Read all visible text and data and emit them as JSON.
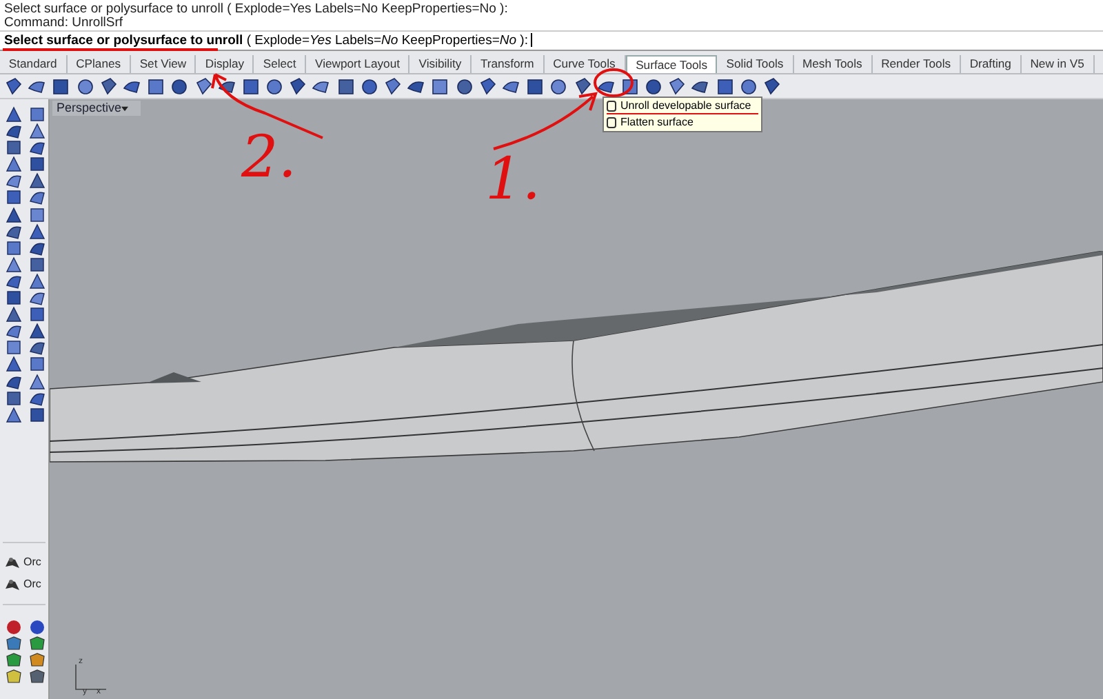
{
  "command_history": [
    "Select surface or polysurface to unroll ( Explode=Yes  Labels=No  KeepProperties=No ):",
    "Command:  UnrollSrf"
  ],
  "command_prompt": {
    "prompt": "Select surface or polysurface to unroll",
    "options": "( Explode=*Yes*  Labels=*No*  KeepProperties=*No* ):"
  },
  "tabs": [
    {
      "label": "Standard",
      "selected": false
    },
    {
      "label": "CPlanes",
      "selected": false
    },
    {
      "label": "Set View",
      "selected": false
    },
    {
      "label": "Display",
      "selected": false
    },
    {
      "label": "Select",
      "selected": false
    },
    {
      "label": "Viewport Layout",
      "selected": false
    },
    {
      "label": "Visibility",
      "selected": false
    },
    {
      "label": "Transform",
      "selected": false
    },
    {
      "label": "Curve Tools",
      "selected": false
    },
    {
      "label": "Surface Tools",
      "selected": true
    },
    {
      "label": "Solid Tools",
      "selected": false
    },
    {
      "label": "Mesh Tools",
      "selected": false
    },
    {
      "label": "Render Tools",
      "selected": false
    },
    {
      "label": "Drafting",
      "selected": false
    },
    {
      "label": "New in V5",
      "selected": false
    }
  ],
  "viewport": {
    "title": "Perspective"
  },
  "popup_menu": [
    "Unroll developable surface",
    "Flatten surface"
  ],
  "side_items": [
    "Orc",
    "Orc"
  ],
  "axes": {
    "z": "z",
    "y": "y",
    "x": "x"
  },
  "annotations": [
    "2.",
    "1."
  ]
}
